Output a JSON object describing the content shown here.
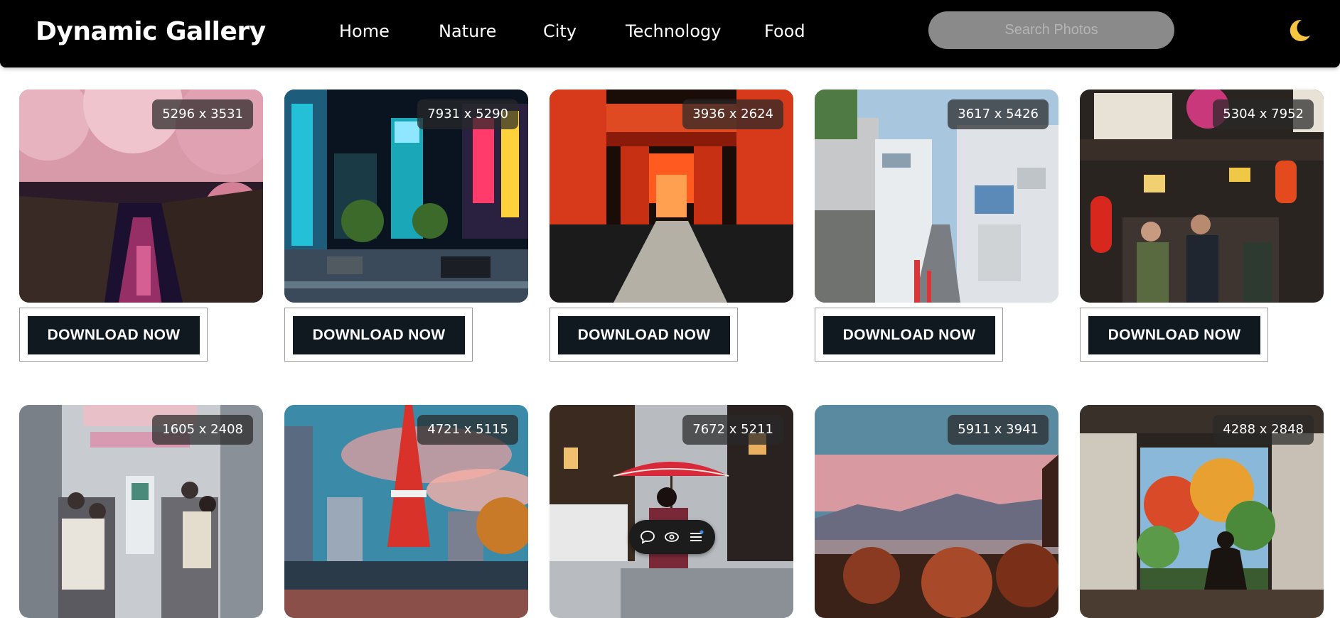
{
  "header": {
    "brand": "Dynamic Gallery",
    "nav": [
      "Home",
      "Nature",
      "City",
      "Technology",
      "Food"
    ],
    "search_placeholder": "Search Photos",
    "theme_toggle_icon": "moon-icon"
  },
  "gallery": {
    "photos": [
      {
        "dimensions": "5296 x 3531",
        "subject": "cherry blossom canal at night",
        "download_label": "DOWNLOAD NOW"
      },
      {
        "dimensions": "7931 x 5290",
        "subject": "neon city street at night",
        "download_label": "DOWNLOAD NOW"
      },
      {
        "dimensions": "3936 x 2624",
        "subject": "red torii gate tunnel",
        "download_label": "DOWNLOAD NOW"
      },
      {
        "dimensions": "3617 x 5426",
        "subject": "narrow residential street",
        "download_label": "DOWNLOAD NOW"
      },
      {
        "dimensions": "5304 x 7952",
        "subject": "crowded market alley with lanterns",
        "download_label": "DOWNLOAD NOW"
      },
      {
        "dimensions": "1605 x 2408",
        "subject": "subway train interior"
      },
      {
        "dimensions": "4721 x 5115",
        "subject": "red tower at sunset"
      },
      {
        "dimensions": "7672 x 5211",
        "subject": "woman with red umbrella on wet street"
      },
      {
        "dimensions": "5911 x 3941",
        "subject": "city skyline with mountains at dusk"
      },
      {
        "dimensions": "4288 x 2848",
        "subject": "person seated at doorway facing garden"
      }
    ]
  },
  "floating_toolbar": {
    "icons": [
      "comment-icon",
      "eye-icon",
      "menu-icon"
    ]
  },
  "colors": {
    "navbar_bg": "#000000",
    "button_bg": "#101820",
    "search_bg": "#8a8a8a",
    "moon": "#f5c542"
  }
}
